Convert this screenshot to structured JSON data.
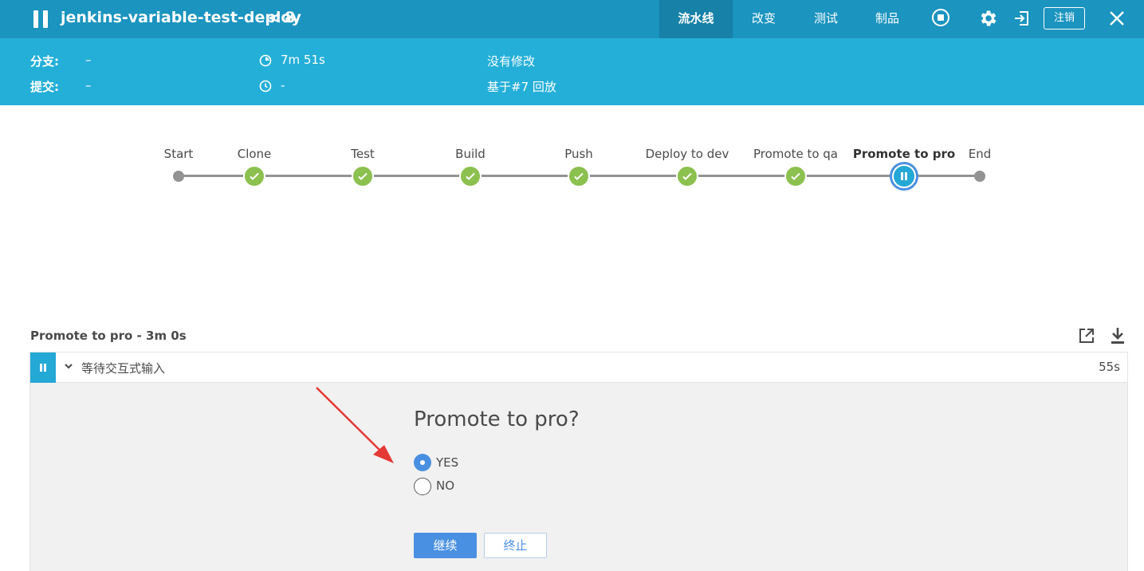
{
  "header": {
    "job_title": "jenkins-variable-test-deploy",
    "back_chevron": "<",
    "run_number": "8",
    "tabs": [
      {
        "label": "流水线",
        "active": true
      },
      {
        "label": "改变",
        "active": false
      },
      {
        "label": "测试",
        "active": false
      },
      {
        "label": "制品",
        "active": false
      }
    ],
    "icons": [
      "pause-icon",
      "stop-icon",
      "gear-icon",
      "exit-icon",
      "close-icon"
    ],
    "logout_label": "注销",
    "colors": {
      "bar": "#1b94bf",
      "active_tab": "#1781a8"
    }
  },
  "run_info": {
    "branch_label": "分支:",
    "branch_value": "–",
    "commit_label": "提交:",
    "commit_value": "–",
    "duration": "7m 51s",
    "started": "-",
    "changes": "没有修改",
    "cause": "基于#7 回放",
    "colors": {
      "bar": "#24afd8"
    }
  },
  "pipeline": {
    "stages": [
      {
        "label": "Start",
        "status": "start"
      },
      {
        "label": "Clone",
        "status": "success"
      },
      {
        "label": "Test",
        "status": "success"
      },
      {
        "label": "Build",
        "status": "success"
      },
      {
        "label": "Push",
        "status": "success"
      },
      {
        "label": "Deploy to dev",
        "status": "success"
      },
      {
        "label": "Promote to qa",
        "status": "success"
      },
      {
        "label": "Promote to pro",
        "status": "paused"
      },
      {
        "label": "End",
        "status": "end"
      }
    ],
    "colors": {
      "success": "#8cc04f",
      "paused": "#24a8d5",
      "line": "#949393"
    }
  },
  "step_section": {
    "title": "Promote to pro - 3m 0s",
    "icons": [
      "popout-icon",
      "download-icon"
    ],
    "step": {
      "name": "等待交互式输入",
      "duration": "55s",
      "status": "paused"
    }
  },
  "input_form": {
    "prompt": "Promote to pro?",
    "options": [
      {
        "label": "YES",
        "selected": true
      },
      {
        "label": "NO",
        "selected": false
      }
    ],
    "continue_label": "继续",
    "abort_label": "终止",
    "colors": {
      "primary": "#4a90e2",
      "annotation_arrow": "#e53935"
    }
  }
}
